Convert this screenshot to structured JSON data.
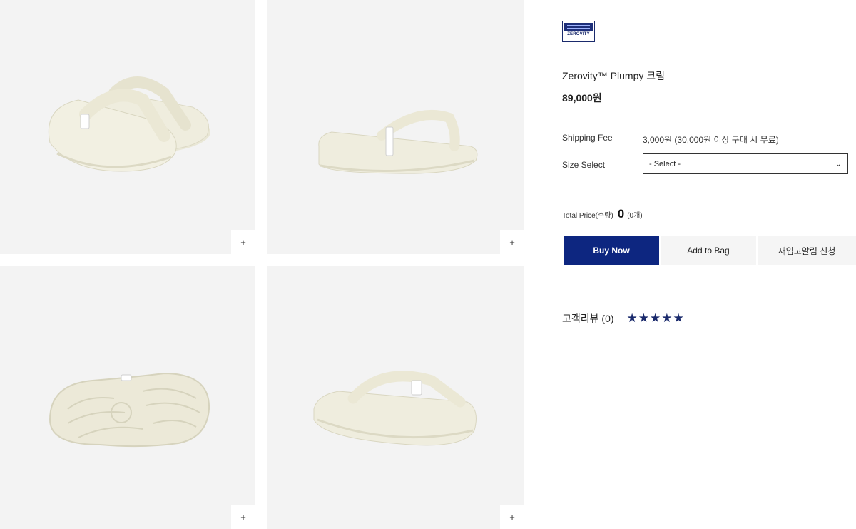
{
  "gallery": {
    "images": [
      {
        "alt": "sandal-pair-front-view"
      },
      {
        "alt": "sandal-side-view"
      },
      {
        "alt": "sandal-sole-view"
      },
      {
        "alt": "sandal-rear-view"
      }
    ],
    "zoom_label": "+"
  },
  "brand": {
    "logo_text": "ZEROVITY"
  },
  "product": {
    "title": "Zerovity™ Plumpy 크림",
    "price": "89,000원",
    "shipping_label": "Shipping Fee",
    "shipping_value": "3,000원 (30,000원 이상 구매 시 무료)",
    "size_label": "Size Select",
    "size_selected": "- Select -",
    "total_label": "Total Price(수량)",
    "total_value": "0",
    "total_qty": "(0개)"
  },
  "actions": {
    "buy_now": "Buy Now",
    "add_to_bag": "Add to Bag",
    "restock": "재입고알림 신청"
  },
  "reviews": {
    "label": "고객리뷰 (0)",
    "stars": "★★★★★"
  },
  "colors": {
    "brand_navy": "#0d2680",
    "tile_bg": "#f3f3f3",
    "sandal": "#f2f0e2"
  }
}
